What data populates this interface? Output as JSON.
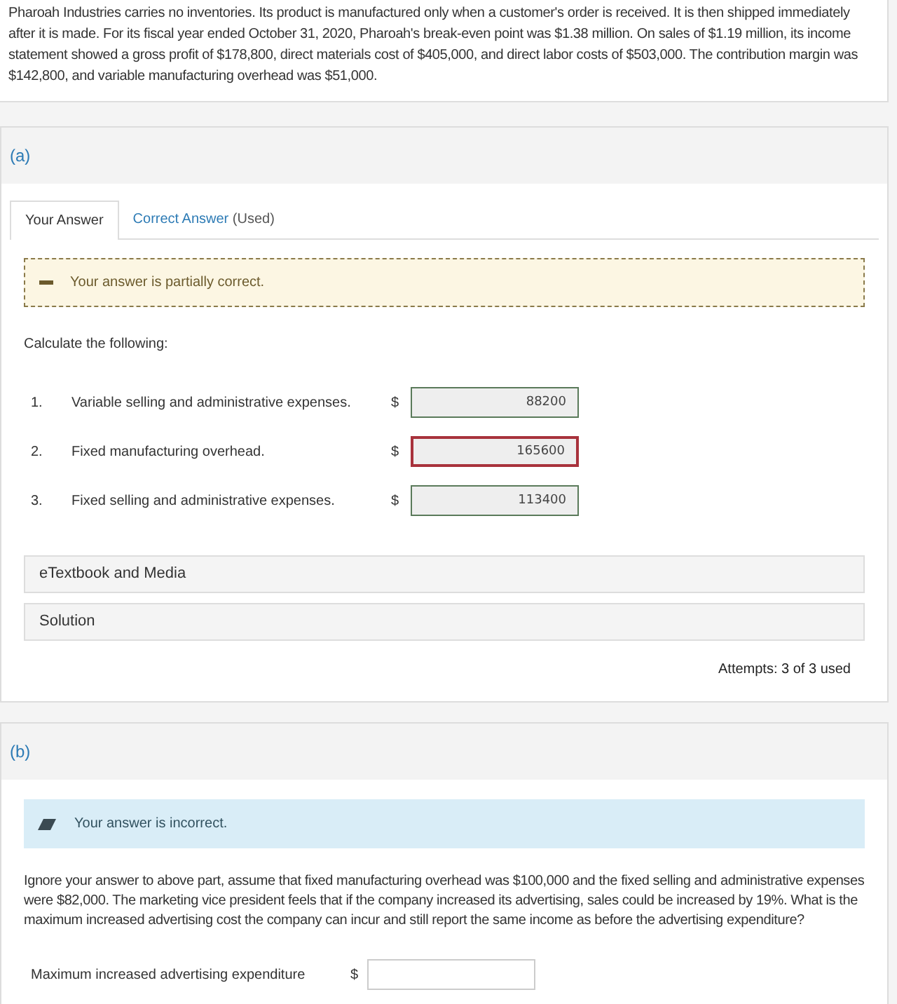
{
  "intro": "Pharoah Industries carries no inventories. Its product is manufactured only when a customer's order is received. It is then shipped immediately after it is made. For its fiscal year ended October 31, 2020, Pharoah's break-even point was $1.38 million. On sales of $1.19 million, its income statement showed a gross profit of $178,800, direct materials cost of $405,000, and direct labor costs of $503,000. The contribution margin was $142,800, and variable manufacturing overhead was $51,000.",
  "part_a": {
    "label": "(a)",
    "tabs": [
      {
        "label": "Your Answer",
        "selected": true
      },
      {
        "label": "Correct Answer",
        "note": "(Used)",
        "selected": false
      }
    ],
    "feedback": {
      "kind": "partial",
      "text": "Your answer is partially correct."
    },
    "prompt": "Calculate the following:",
    "items": [
      {
        "number": "1.",
        "label": "Variable selling and administrative expenses.",
        "currency": "$",
        "value": "88200",
        "correct": true
      },
      {
        "number": "2.",
        "label": "Fixed manufacturing overhead.",
        "currency": "$",
        "value": "165600",
        "correct": false
      },
      {
        "number": "3.",
        "label": "Fixed selling and administrative expenses.",
        "currency": "$",
        "value": "113400",
        "correct": true
      }
    ],
    "resources": [
      "eTextbook and Media",
      "Solution"
    ],
    "attempts": "Attempts: 3 of 3 used"
  },
  "part_b": {
    "label": "(b)",
    "feedback": {
      "kind": "incorrect",
      "text": "Your answer is incorrect."
    },
    "question": "Ignore your answer to above part, assume that fixed manufacturing overhead was $100,000 and the fixed selling and administrative expenses were $82,000. The marketing vice president feels that if the company increased its advertising, sales could be increased by 19%. What is the maximum increased advertising cost the company can incur and still report the same income as before the advertising expenditure?",
    "field_label": "Maximum increased advertising expenditure",
    "currency": "$"
  }
}
